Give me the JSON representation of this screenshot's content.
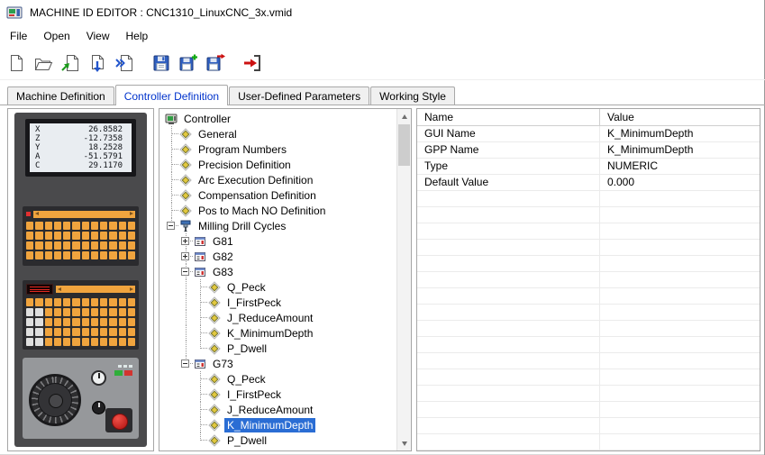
{
  "colors": {
    "selection": "#2a6dd4",
    "tab-active": "#0033cc",
    "key-orange": "#f0a43e",
    "machine-body": "#4a4a4c"
  },
  "window": {
    "title": "MACHINE ID EDITOR : CNC1310_LinuxCNC_3x.vmid"
  },
  "menu": {
    "items": [
      "File",
      "Open",
      "View",
      "Help"
    ]
  },
  "toolbar": {
    "buttons": [
      "new-document",
      "open-folder",
      "import-document",
      "save-document",
      "send-document",
      "save",
      "save-new",
      "save-export",
      "exit"
    ]
  },
  "tabs": [
    {
      "label": "Machine Definition",
      "active": false
    },
    {
      "label": "Controller Definition",
      "active": true
    },
    {
      "label": "User-Defined Parameters",
      "active": false
    },
    {
      "label": "Working Style",
      "active": false
    }
  ],
  "machine_panel": {
    "display": [
      {
        "axis": "X",
        "value": "26.8582"
      },
      {
        "axis": "Z",
        "value": "-12.7358"
      },
      {
        "axis": "Y",
        "value": "18.2528"
      },
      {
        "axis": "A",
        "value": "-51.5791"
      },
      {
        "axis": "C",
        "value": "29.1170"
      }
    ]
  },
  "tree": {
    "items": [
      {
        "label": "Controller",
        "depth": 0,
        "icon": "controller"
      },
      {
        "label": "General",
        "depth": 1,
        "icon": "diamond"
      },
      {
        "label": "Program Numbers",
        "depth": 1,
        "icon": "diamond"
      },
      {
        "label": "Precision Definition",
        "depth": 1,
        "icon": "diamond"
      },
      {
        "label": "Arc Execution Definition",
        "depth": 1,
        "icon": "diamond"
      },
      {
        "label": "Compensation Definition",
        "depth": 1,
        "icon": "diamond"
      },
      {
        "label": "Pos to Mach NO Definition",
        "depth": 1,
        "icon": "diamond"
      },
      {
        "label": "Milling Drill Cycles",
        "depth": 1,
        "icon": "drill",
        "expander": "minus"
      },
      {
        "label": "G81",
        "depth": 2,
        "icon": "gcode",
        "expander": "plus"
      },
      {
        "label": "G82",
        "depth": 2,
        "icon": "gcode",
        "expander": "plus"
      },
      {
        "label": "G83",
        "depth": 2,
        "icon": "gcode",
        "expander": "minus"
      },
      {
        "label": "Q_Peck",
        "depth": 3,
        "icon": "param"
      },
      {
        "label": "I_FirstPeck",
        "depth": 3,
        "icon": "param"
      },
      {
        "label": "J_ReduceAmount",
        "depth": 3,
        "icon": "param"
      },
      {
        "label": "K_MinimumDepth",
        "depth": 3,
        "icon": "param"
      },
      {
        "label": "P_Dwell",
        "depth": 3,
        "icon": "param"
      },
      {
        "label": "G73",
        "depth": 2,
        "icon": "gcode",
        "expander": "minus"
      },
      {
        "label": "Q_Peck",
        "depth": 3,
        "icon": "param"
      },
      {
        "label": "I_FirstPeck",
        "depth": 3,
        "icon": "param"
      },
      {
        "label": "J_ReduceAmount",
        "depth": 3,
        "icon": "param"
      },
      {
        "label": "K_MinimumDepth",
        "depth": 3,
        "icon": "param",
        "selected": true
      },
      {
        "label": "P_Dwell",
        "depth": 3,
        "icon": "param"
      }
    ]
  },
  "properties": {
    "columns": [
      "Name",
      "Value"
    ],
    "rows": [
      {
        "name": "GUI Name",
        "value": "K_MinimumDepth"
      },
      {
        "name": "GPP Name",
        "value": "K_MinimumDepth"
      },
      {
        "name": "Type",
        "value": "NUMERIC"
      },
      {
        "name": "Default Value",
        "value": "0.000"
      }
    ]
  }
}
